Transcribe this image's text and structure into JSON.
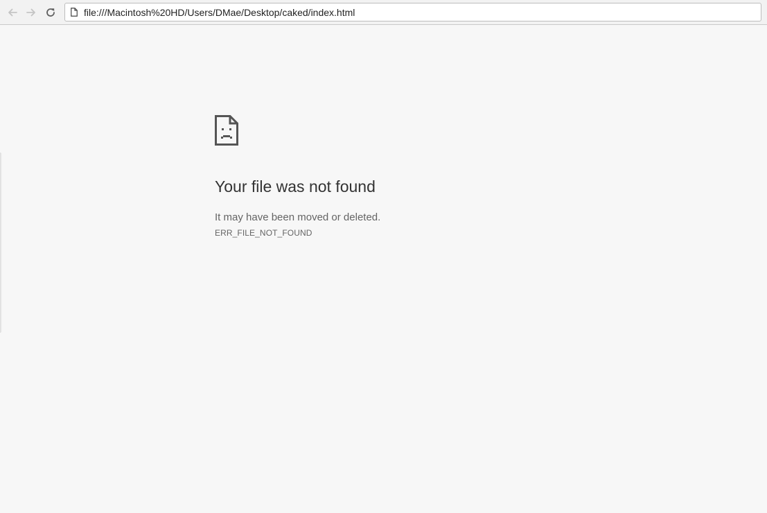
{
  "browser": {
    "url": "file:///Macintosh%20HD/Users/DMae/Desktop/caked/index.html",
    "back_icon": "arrow-left-icon",
    "forward_icon": "arrow-right-icon",
    "reload_icon": "reload-icon",
    "page_icon": "file-icon"
  },
  "error_page": {
    "icon": "sad-file-icon",
    "title": "Your file was not found",
    "description": "It may have been moved or deleted.",
    "code": "ERR_FILE_NOT_FOUND"
  },
  "colors": {
    "page_background": "#f7f7f7",
    "title_text": "#333333",
    "secondary_text": "#646464"
  }
}
